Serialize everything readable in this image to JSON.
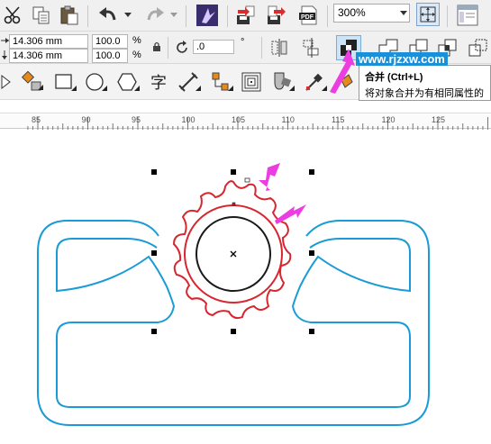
{
  "toolbar": {
    "zoom_value": "300%"
  },
  "property_bar": {
    "width_value": "14.306 mm",
    "height_value": "14.306 mm",
    "scale_x": "100.0",
    "scale_y": "100.0",
    "percent_x": "%",
    "percent_y": "%",
    "rotation_value": ".0",
    "degree_symbol": "°"
  },
  "toolbox": {
    "text_tool_glyph": "字"
  },
  "tooltip": {
    "title": "合并 (Ctrl+L)",
    "description": "将对象合并为有相同属性的"
  },
  "watermark": "www.rjzxw.com",
  "ruler": {
    "labels": [
      "85",
      "90",
      "95",
      "100",
      "105",
      "110",
      "115",
      "120",
      "125"
    ]
  },
  "colors": {
    "outer_shape": "#1a9bd7",
    "seal": "#d8262f",
    "circle": "#1a1a1a",
    "arrow": "#ec3ee0",
    "merge_highlight": "#cce4f7"
  },
  "icons": [
    "scissors-icon",
    "copy-icon",
    "paste-icon",
    "undo-icon",
    "redo-icon",
    "launcher-icon",
    "import-icon",
    "export-icon",
    "publish-pdf-icon",
    "fullscreen-icon",
    "options-icon",
    "lock-ratio-icon",
    "rotate-icon",
    "mirror-icon",
    "align-icon",
    "combine-icon",
    "weld-icon",
    "trim-icon",
    "intersect-icon",
    "simplify-icon"
  ]
}
